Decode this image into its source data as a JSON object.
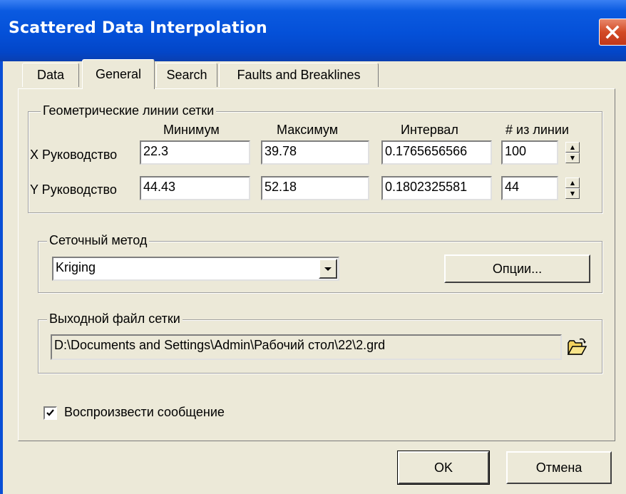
{
  "window": {
    "title": "Scattered Data Interpolation"
  },
  "tabs": [
    {
      "label": "Data"
    },
    {
      "label": "General"
    },
    {
      "label": "Search"
    },
    {
      "label": "Faults and Breaklines"
    }
  ],
  "grid_lines": {
    "legend": "Геометрические линии сетки",
    "headers": {
      "min": "Минимум",
      "max": "Максимум",
      "interval": "Интервал",
      "count": "# из линии"
    },
    "rows": [
      {
        "label": "X Руководство",
        "min": "22.3",
        "max": "39.78",
        "interval": "0.1765656566",
        "count": "100"
      },
      {
        "label": "Y Руководство",
        "min": "44.43",
        "max": "52.18",
        "interval": "0.1802325581",
        "count": "44"
      }
    ]
  },
  "grid_method": {
    "legend": "Сеточный метод",
    "selected": "Kriging",
    "options_button": "Опции..."
  },
  "output_file": {
    "legend": "Выходной файл сетки",
    "path": "D:\\Documents and Settings\\Admin\\Рабочий стол\\22\\2.grd",
    "browse_icon": "folder-open-icon"
  },
  "report": {
    "label": "Воспроизвести сообщение",
    "checked": true
  },
  "buttons": {
    "ok": "OK",
    "cancel": "Отмена"
  },
  "colors": {
    "titlebar": "#0450d8",
    "dialog_bg": "#ece9d8",
    "close": "#d34a25"
  }
}
